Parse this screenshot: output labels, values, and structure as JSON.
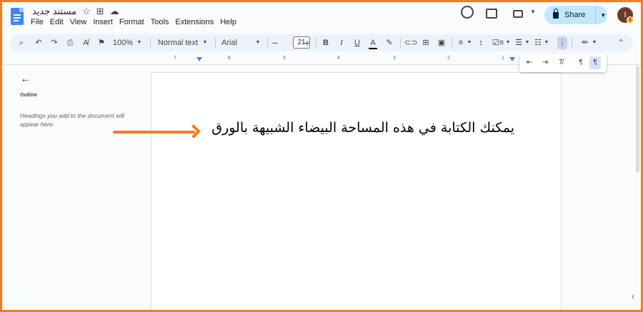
{
  "titlebar": {
    "doc_title": "مستند جديد",
    "menu": [
      "File",
      "Edit",
      "View",
      "Insert",
      "Format",
      "Tools",
      "Extensions",
      "Help"
    ],
    "share_label": "Share",
    "avatar_initial": "I",
    "avatar_badge": "1"
  },
  "toolbar": {
    "zoom": "100%",
    "style": "Normal text",
    "font": "Arial",
    "font_size": "21"
  },
  "ruler": [
    "7",
    "6",
    "5",
    "4",
    "3",
    "2",
    "1"
  ],
  "outline": {
    "title": "Outline",
    "hint": "Headings you add to the document will appear here."
  },
  "document": {
    "text": "يمكنك الكتابة في هذه المساحة البيضاء الشبيهة بالورق"
  },
  "colors": {
    "accent_arrow": "#f57c1f",
    "share_bg": "#c2e7ff",
    "toolbar_bg": "#edf2fa"
  }
}
